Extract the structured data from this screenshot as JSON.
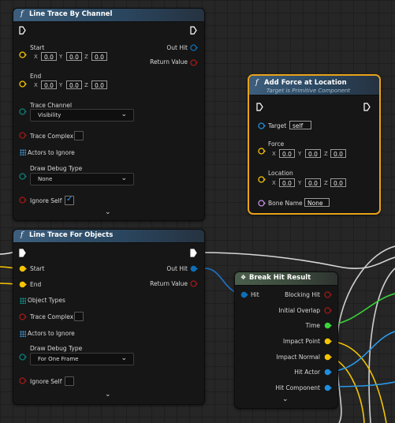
{
  "colors": {
    "exec": "#ffffff",
    "struct": "#0e6fb8",
    "vector": "#f5c400",
    "object": "#1e8fe0",
    "bool": "#8b0000",
    "float": "#4ad44a",
    "name": "#c58fe6",
    "trace_channel": "#0a7e79",
    "selection": "#e8a21a"
  },
  "icons": {
    "function": "f-function-icon",
    "node_struct": "struct-icon",
    "expand": "chevron-down-icon",
    "array": "array-grid-icon"
  },
  "node_line_trace_channel": {
    "title": "Line Trace By Channel",
    "start_label": "Start",
    "end_label": "End",
    "start": {
      "x": "0.0",
      "y": "0.0",
      "z": "0.0"
    },
    "end": {
      "x": "0.0",
      "y": "0.0",
      "z": "0.0"
    },
    "axis_x": "X",
    "axis_y": "Y",
    "axis_z": "Z",
    "trace_channel_label": "Trace Channel",
    "trace_channel_value": "Visibility",
    "trace_complex_label": "Trace Complex",
    "actors_to_ignore_label": "Actors to Ignore",
    "draw_debug_label": "Draw Debug Type",
    "draw_debug_value": "None",
    "ignore_self_label": "Ignore Self",
    "out_hit_label": "Out Hit",
    "return_value_label": "Return Value"
  },
  "node_line_trace_objects": {
    "title": "Line Trace For Objects",
    "start_label": "Start",
    "end_label": "End",
    "object_types_label": "Object Types",
    "trace_complex_label": "Trace Complex",
    "actors_to_ignore_label": "Actors to Ignore",
    "draw_debug_label": "Draw Debug Type",
    "draw_debug_value": "For One Frame",
    "ignore_self_label": "Ignore Self",
    "out_hit_label": "Out Hit",
    "return_value_label": "Return Value"
  },
  "node_add_force": {
    "title": "Add Force at Location",
    "subtitle": "Target is Primitive Component",
    "target_label": "Target",
    "target_value": "self",
    "force_label": "Force",
    "location_label": "Location",
    "force": {
      "x": "0.0",
      "y": "0.0",
      "z": "0.0"
    },
    "location": {
      "x": "0.0",
      "y": "0.0",
      "z": "0.0"
    },
    "axis_x": "X",
    "axis_y": "Y",
    "axis_z": "Z",
    "bone_name_label": "Bone Name",
    "bone_name_value": "None"
  },
  "node_break_hit": {
    "title": "Break Hit Result",
    "hit_label": "Hit",
    "outputs": [
      "Blocking Hit",
      "Initial Overlap",
      "Time",
      "Impact Point",
      "Impact Normal",
      "Hit Actor",
      "Hit Component"
    ]
  }
}
